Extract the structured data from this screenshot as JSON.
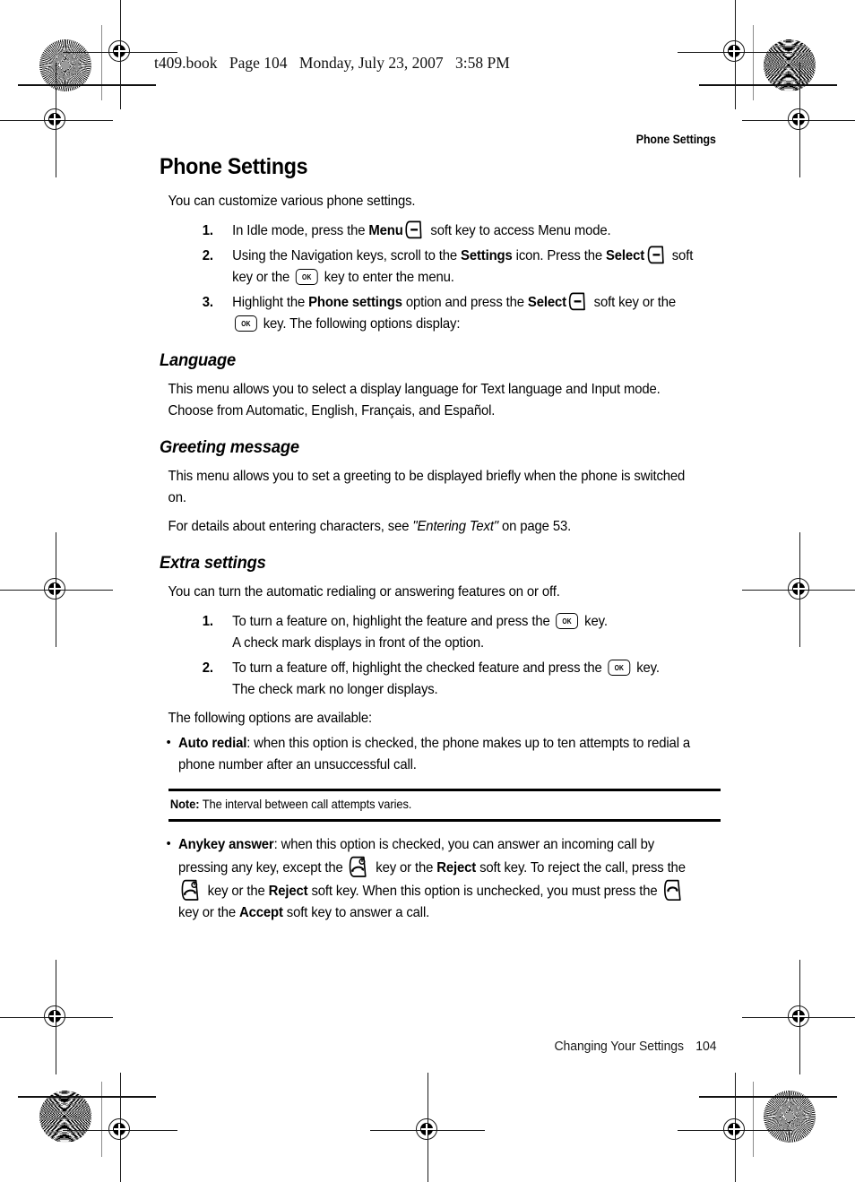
{
  "file_header": {
    "filename": "t409.book",
    "page_marker": "Page 104",
    "date": "Monday, July 23, 2007",
    "time": "3:58 PM"
  },
  "running_head": "Phone Settings",
  "page_title": "Phone Settings",
  "intro": "You can customize various phone settings.",
  "steps_main": [
    {
      "num": "1.",
      "parts": [
        {
          "t": "text",
          "v": "In Idle mode, press the "
        },
        {
          "t": "bold",
          "v": "Menu"
        },
        {
          "t": "key",
          "v": "soft-key"
        },
        {
          "t": "text",
          "v": " soft key to access Menu mode."
        }
      ]
    },
    {
      "num": "2.",
      "parts": [
        {
          "t": "text",
          "v": "Using the Navigation keys, scroll to the "
        },
        {
          "t": "bold",
          "v": "Settings"
        },
        {
          "t": "text",
          "v": " icon. Press the "
        },
        {
          "t": "bold",
          "v": "Select"
        },
        {
          "t": "key",
          "v": "soft-key"
        },
        {
          "t": "text",
          "v": " soft key or the "
        },
        {
          "t": "key",
          "v": "ok-key"
        },
        {
          "t": "text",
          "v": " key to enter the menu."
        }
      ]
    },
    {
      "num": "3.",
      "parts": [
        {
          "t": "text",
          "v": "Highlight the "
        },
        {
          "t": "bold",
          "v": "Phone settings"
        },
        {
          "t": "text",
          "v": " option and press the "
        },
        {
          "t": "bold",
          "v": "Select"
        },
        {
          "t": "key",
          "v": "soft-key"
        },
        {
          "t": "text",
          "v": " soft key or the "
        },
        {
          "t": "key",
          "v": "ok-key"
        },
        {
          "t": "text",
          "v": " key. The following options display:"
        }
      ]
    }
  ],
  "sections": {
    "language": {
      "heading": "Language",
      "body": "This menu allows you to select a display language for Text language and Input mode. Choose from Automatic, English, Français, and Español."
    },
    "greeting": {
      "heading": "Greeting message",
      "body": "This menu allows you to set a greeting to be displayed briefly when the phone is switched on.",
      "cross_ref_before": "For details about entering characters, see ",
      "cross_ref_title": "\"Entering Text\"",
      "cross_ref_after": " on page 53."
    },
    "extra": {
      "heading": "Extra settings",
      "intro": "You can turn the automatic redialing or answering features on or off.",
      "steps": [
        {
          "num": "1.",
          "parts": [
            {
              "t": "text",
              "v": "To turn a feature on, highlight the feature and press the "
            },
            {
              "t": "key",
              "v": "ok-key"
            },
            {
              "t": "text",
              "v": " key."
            },
            {
              "t": "br",
              "v": ""
            },
            {
              "t": "text",
              "v": "A check mark displays in front of the option."
            }
          ]
        },
        {
          "num": "2.",
          "parts": [
            {
              "t": "text",
              "v": "To turn a feature off, highlight the checked feature and press the "
            },
            {
              "t": "key",
              "v": "ok-key"
            },
            {
              "t": "text",
              "v": " key."
            },
            {
              "t": "br",
              "v": ""
            },
            {
              "t": "text",
              "v": "The check mark no longer displays."
            }
          ]
        }
      ],
      "options_lead": "The following options are available:",
      "bullets_before_note": [
        {
          "bullet": "•",
          "parts": [
            {
              "t": "bold",
              "v": "Auto redial"
            },
            {
              "t": "text",
              "v": ": when this option is checked, the phone makes up to ten attempts to redial a phone number after an unsuccessful call."
            }
          ]
        }
      ],
      "note": {
        "label": "Note:",
        "text": " The interval between call attempts varies."
      },
      "bullets_after_note": [
        {
          "bullet": "•",
          "parts": [
            {
              "t": "bold",
              "v": "Anykey answer"
            },
            {
              "t": "text",
              "v": ": when this option is checked, you can answer an incoming call by pressing any key, except the "
            },
            {
              "t": "key",
              "v": "end-key"
            },
            {
              "t": "text",
              "v": " key or the "
            },
            {
              "t": "bold",
              "v": "Reject"
            },
            {
              "t": "text",
              "v": " soft key. To reject the call, press the "
            },
            {
              "t": "key",
              "v": "end-key"
            },
            {
              "t": "text",
              "v": " key or the "
            },
            {
              "t": "bold",
              "v": "Reject"
            },
            {
              "t": "text",
              "v": " soft key. When this option is unchecked, you must press the "
            },
            {
              "t": "key",
              "v": "send-key"
            },
            {
              "t": "text",
              "v": " key or the "
            },
            {
              "t": "bold",
              "v": "Accept"
            },
            {
              "t": "text",
              "v": " soft key to answer a call."
            }
          ]
        }
      ]
    }
  },
  "footer": {
    "chapter": "Changing Your Settings",
    "page_number": "104"
  },
  "keys": {
    "ok-key": {
      "label": "OK",
      "name": "ok-key-icon"
    },
    "soft-key": {
      "label": "–",
      "name": "soft-key-icon"
    },
    "send-key": {
      "label": "",
      "name": "send-key-icon"
    },
    "end-key": {
      "label": "",
      "name": "end-key-icon"
    }
  },
  "colors": {
    "ink": "#000000",
    "paper": "#ffffff",
    "guide": "#8c8c8c"
  }
}
